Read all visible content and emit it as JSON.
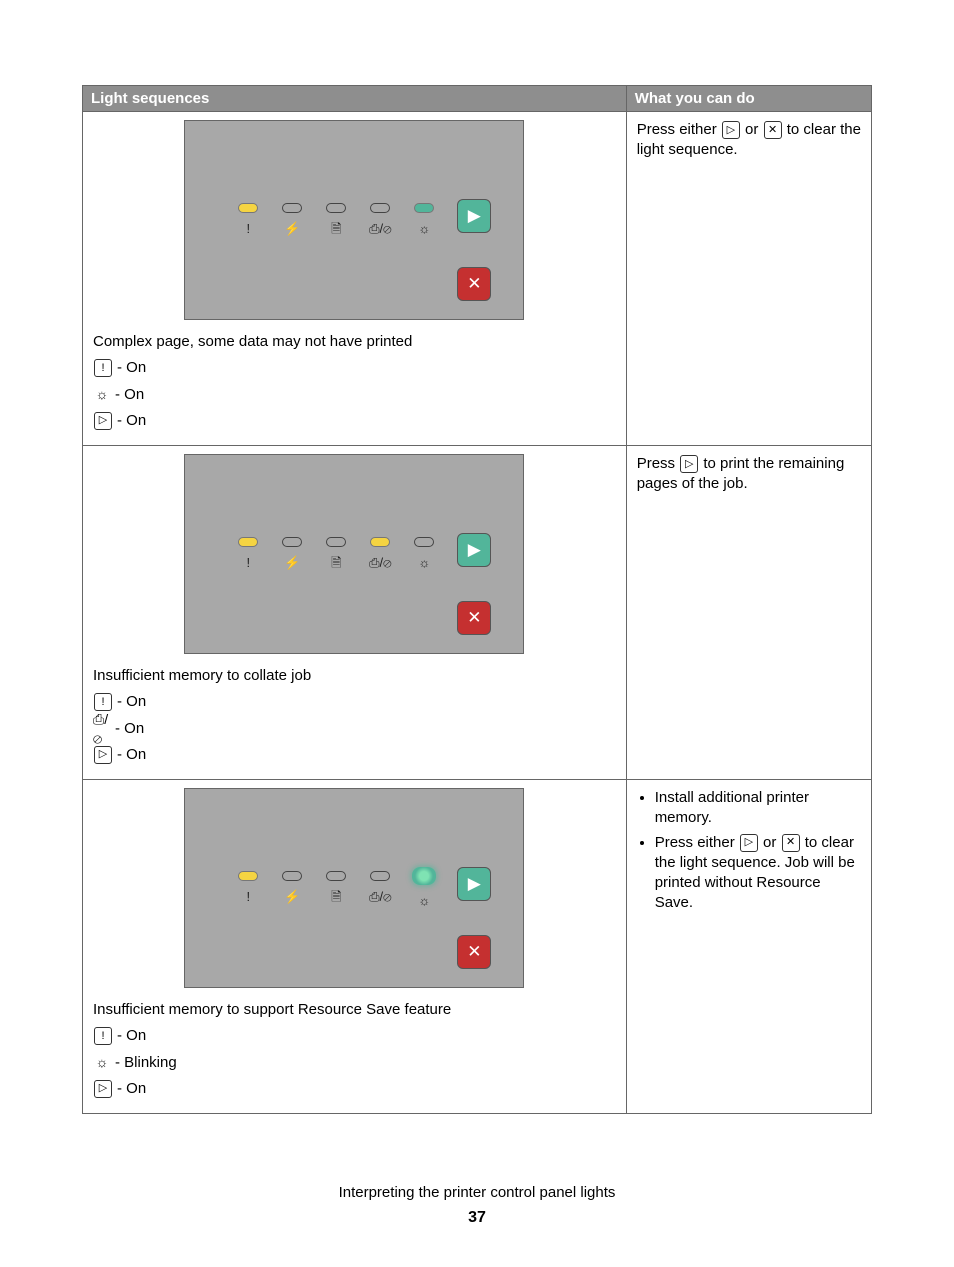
{
  "headers": {
    "col1": "Light sequences",
    "col2": "What you can do"
  },
  "panel_symbols": [
    "!",
    "⚡",
    "🗎",
    "⎙/⊘",
    "☼"
  ],
  "row1": {
    "caption": "Complex page, some data may not have printed",
    "states": [
      {
        "icon": "exclaim-box",
        "label": " - On"
      },
      {
        "icon": "sun",
        "label": " - On"
      },
      {
        "icon": "play-box",
        "label": " - On"
      }
    ],
    "action_pre": "Press either ",
    "action_mid": " or ",
    "action_post": " to clear the light sequence."
  },
  "row2": {
    "caption": "Insufficient memory to collate job",
    "states": [
      {
        "icon": "exclaim-box",
        "label": " - On"
      },
      {
        "icon": "tray-gear",
        "label": " - On"
      },
      {
        "icon": "play-box",
        "label": " - On"
      }
    ],
    "action_pre": "Press ",
    "action_post": " to print the remaining pages of the job."
  },
  "row3": {
    "caption": "Insufficient memory to support Resource Save feature",
    "states": [
      {
        "icon": "exclaim-box",
        "label": " - On"
      },
      {
        "icon": "sun",
        "label": " - Blinking"
      },
      {
        "icon": "play-box",
        "label": " - On"
      }
    ],
    "actions": {
      "item1": "Install additional printer memory.",
      "item2_pre": "Press either ",
      "item2_mid": " or ",
      "item2_post": " to clear the light sequence. Job will be printed without Resource Save."
    }
  },
  "footer": "Interpreting the printer control panel lights",
  "page_number": "37"
}
